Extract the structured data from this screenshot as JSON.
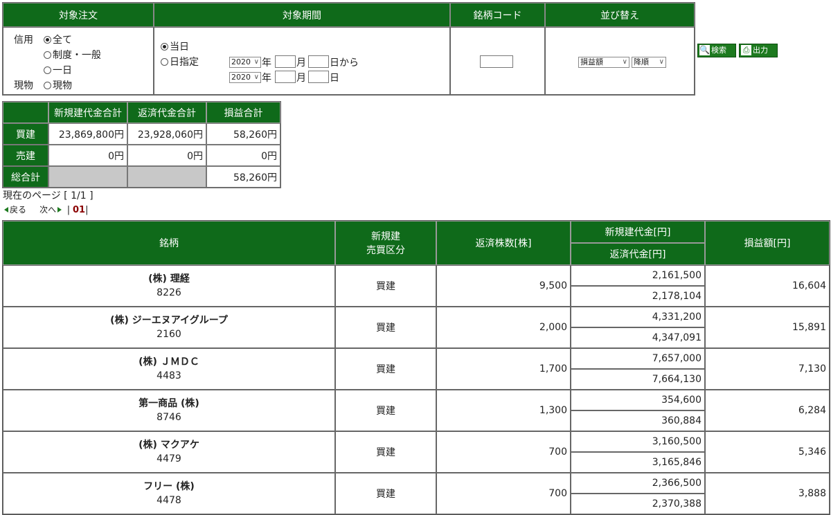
{
  "filter": {
    "headers": [
      "対象注文",
      "対象期間",
      "銘柄コード",
      "並び替え"
    ],
    "order": {
      "credit_label": "信用",
      "spot_label": "現物",
      "options": [
        "全て",
        "制度・一般",
        "一日",
        "現物"
      ],
      "selected": "全て"
    },
    "period": {
      "today_label": "当日",
      "date_label": "日指定",
      "from_year": "2020",
      "to_year": "2020",
      "year_unit": "年",
      "month_unit": "月",
      "from_day_unit": "日から",
      "to_day_unit": "日",
      "selected": "当日"
    },
    "code": {
      "value": ""
    },
    "sort": {
      "field": "損益額",
      "direction": "降順"
    }
  },
  "buttons": {
    "search": "検索",
    "output": "出力",
    "search_icon": "magnifier-icon",
    "output_icon": "printer-icon"
  },
  "summary": {
    "headers": [
      "新規建代金合計",
      "返済代金合計",
      "損益合計"
    ],
    "rows": [
      {
        "label": "買建",
        "new_total": "23,869,800円",
        "close_total": "23,928,060円",
        "pl_total": "58,260円"
      },
      {
        "label": "売建",
        "new_total": "0円",
        "close_total": "0円",
        "pl_total": "0円"
      },
      {
        "label": "総合計",
        "new_total": "",
        "close_total": "",
        "pl_total": "58,260円"
      }
    ]
  },
  "pagination": {
    "current": "現在のページ [ 1/1 ]",
    "prev": "戻る",
    "next": "次へ",
    "page": "01"
  },
  "main": {
    "headers": {
      "name": "銘柄",
      "type_line1": "新規建",
      "type_line2": "売買区分",
      "shares": "返済株数[株]",
      "new_amount": "新規建代金[円]",
      "close_amount": "返済代金[円]",
      "pl": "損益額[円]"
    },
    "rows": [
      {
        "name": "(株) 理経",
        "code": "8226",
        "type": "買建",
        "shares": "9,500",
        "new_amount": "2,161,500",
        "close_amount": "2,178,104",
        "pl": "16,604"
      },
      {
        "name": "(株) ジーエヌアイグループ",
        "code": "2160",
        "type": "買建",
        "shares": "2,000",
        "new_amount": "4,331,200",
        "close_amount": "4,347,091",
        "pl": "15,891"
      },
      {
        "name": "(株) ＪＭＤＣ",
        "code": "4483",
        "type": "買建",
        "shares": "1,700",
        "new_amount": "7,657,000",
        "close_amount": "7,664,130",
        "pl": "7,130"
      },
      {
        "name": "第一商品 (株)",
        "code": "8746",
        "type": "買建",
        "shares": "1,300",
        "new_amount": "354,600",
        "close_amount": "360,884",
        "pl": "6,284"
      },
      {
        "name": "(株) マクアケ",
        "code": "4479",
        "type": "買建",
        "shares": "700",
        "new_amount": "3,160,500",
        "close_amount": "3,165,846",
        "pl": "5,346"
      },
      {
        "name": "フリー (株)",
        "code": "4478",
        "type": "買建",
        "shares": "700",
        "new_amount": "2,366,500",
        "close_amount": "2,370,388",
        "pl": "3,888"
      }
    ]
  },
  "colors": {
    "header_green": "#0f6a1a",
    "button_green": "#1d7a1f",
    "gray_cell": "#c8c8c8",
    "page_num": "#8b0000"
  }
}
